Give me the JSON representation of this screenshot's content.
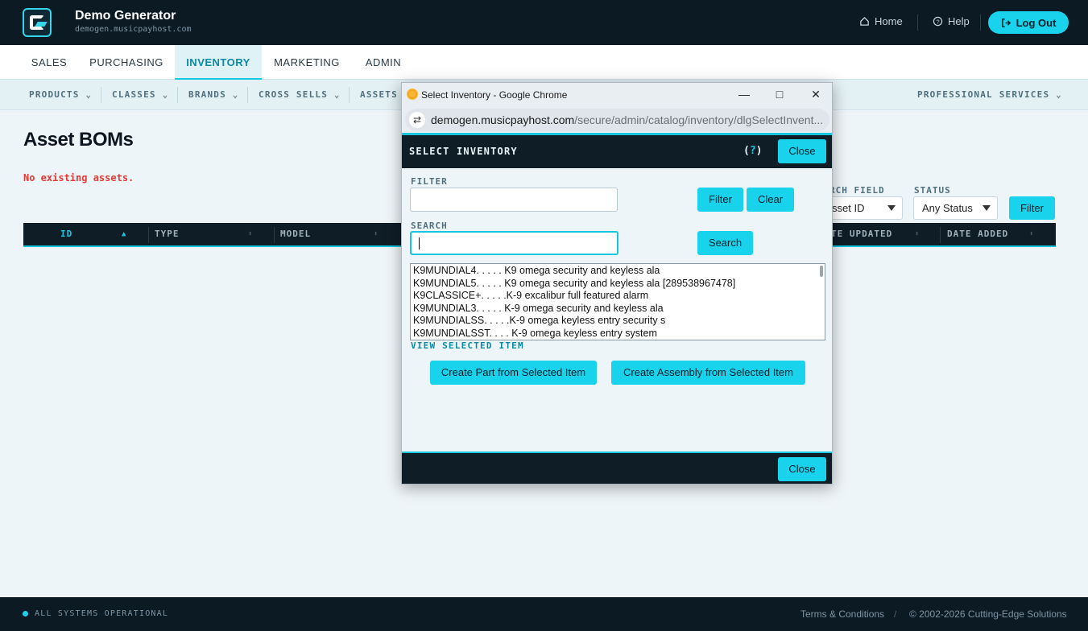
{
  "header": {
    "brand_title": "Demo Generator",
    "brand_sub": "demogen.musicpayhost.com",
    "home": "Home",
    "help": "Help",
    "logout": "Log Out"
  },
  "main_nav": [
    "SALES",
    "PURCHASING",
    "INVENTORY",
    "MARKETING",
    "ADMIN"
  ],
  "sub_nav": {
    "products": "PRODUCTS",
    "classes": "CLASSES",
    "brands": "BRANDS",
    "cross_sells": "CROSS SELLS",
    "assets": "ASSETS",
    "professional_services": "PROFESSIONAL SERVICES"
  },
  "page": {
    "title": "Asset BOMs",
    "no_assets": "No existing assets.",
    "search_field_label": "RCH FIELD",
    "search_field_value": "sset ID",
    "status_label": "STATUS",
    "status_value": "Any Status",
    "filter_button": "Filter"
  },
  "table": {
    "headers": [
      "ID",
      "TYPE",
      "MODEL",
      "TE UPDATED",
      "DATE ADDED"
    ]
  },
  "footer": {
    "status": "ALL SYSTEMS OPERATIONAL",
    "terms": "Terms & Conditions",
    "separator": "/",
    "copyright": "© 2002-2026 Cutting-Edge Solutions"
  },
  "popup": {
    "window_title": "Select Inventory - Google Chrome",
    "url_host": "demogen.musicpayhost.com",
    "url_path": "/secure/admin/catalog/inventory/dlgSelectInvent...",
    "dialog_title": "SELECT INVENTORY",
    "help_open": "(",
    "help_q": "?",
    "help_close": ")",
    "close_button": "Close",
    "filter_label": "FILTER",
    "filter_value": "",
    "filter_button": "Filter",
    "clear_button": "Clear",
    "search_label": "SEARCH",
    "search_value": "",
    "search_button": "Search",
    "list_items": [
      "K9MUNDIAL4. . . . . K9 omega security and keyless ala",
      "K9MUNDIAL5. . . . . K9 omega security and keyless ala [289538967478]",
      "K9CLASSICE+. . . . .K-9 excalibur full featured alarm",
      "K9MUNDIAL3. . . . . K-9 omega security and keyless ala",
      "K9MUNDIALSS. . . . .K-9 omega keyless entry security s",
      "K9MUNDIALSST. . . . K-9 omega keyless entry system"
    ],
    "view_selected": "VIEW SELECTED ITEM",
    "create_part": "Create Part from Selected Item",
    "create_assembly": "Create Assembly from Selected Item",
    "footer_close": "Close"
  },
  "colors": {
    "accent": "#19d3ec",
    "dark": "#0f1d27",
    "error": "#e53935"
  }
}
